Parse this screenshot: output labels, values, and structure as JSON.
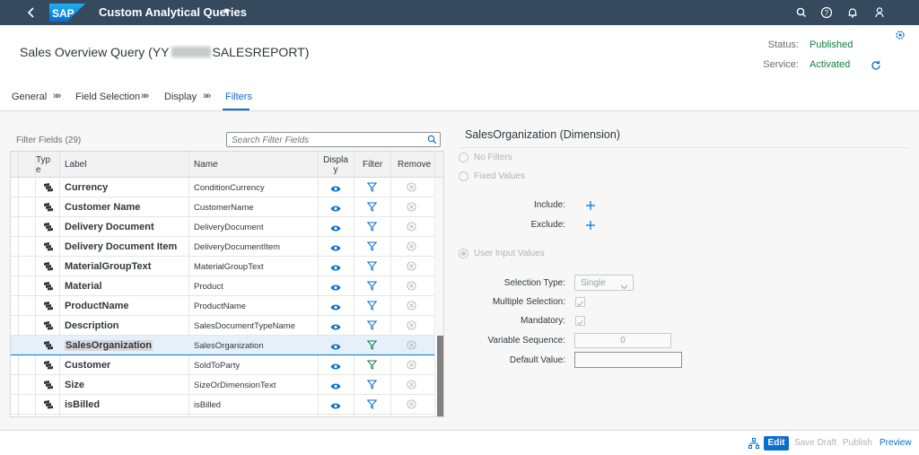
{
  "shell": {
    "logo_text": "SAP",
    "app_title": "Custom Analytical Queries",
    "icons": [
      "back-icon",
      "search-icon",
      "help-icon",
      "notifications-icon",
      "user-icon"
    ]
  },
  "header": {
    "title_prefix": "Sales Overview Query (YY",
    "title_suffix": "SALESREPORT)",
    "status_label": "Status:",
    "status_value": "Published",
    "service_label": "Service:",
    "service_value": "Activated"
  },
  "tabs": {
    "items": [
      "General",
      "Field Selection",
      "Display",
      "Filters"
    ],
    "separator": "»»",
    "selected": "Filters"
  },
  "filter_fields": {
    "title": "Filter Fields (29)",
    "search_placeholder": "Search Filter Fields",
    "columns": {
      "type": "Typ\ne",
      "label": "Label",
      "name": "Name",
      "display": "Displa\ny",
      "filter": "Filter",
      "remove": "Remove"
    },
    "rows": [
      {
        "label": "Currency",
        "name": "ConditionCurrency"
      },
      {
        "label": "Customer Name",
        "name": "CustomerName"
      },
      {
        "label": "Delivery Document",
        "name": "DeliveryDocument"
      },
      {
        "label": "Delivery Document Item",
        "name": "DeliveryDocumentItem"
      },
      {
        "label": "MaterialGroupText",
        "name": "MaterialGroupText"
      },
      {
        "label": "Material",
        "name": "Product"
      },
      {
        "label": "ProductName",
        "name": "ProductName"
      },
      {
        "label": "Description",
        "name": "SalesDocumentTypeName"
      },
      {
        "label": "SalesOrganization",
        "name": "SalesOrganization",
        "selected": true
      },
      {
        "label": "Customer",
        "name": "SoldToParty",
        "filter_active": true
      },
      {
        "label": "Size",
        "name": "SizeOrDimensionText"
      },
      {
        "label": "isBilled",
        "name": "isBilled"
      }
    ]
  },
  "detail": {
    "title": "SalesOrganization (Dimension)",
    "no_filters": "No Filters",
    "fixed_values": "Fixed Values",
    "include_label": "Include:",
    "exclude_label": "Exclude:",
    "user_input_values": "User Input Values",
    "selection_type_label": "Selection Type:",
    "selection_type_value": "Single",
    "multiple_selection_label": "Multiple Selection:",
    "mandatory_label": "Mandatory:",
    "variable_sequence_label": "Variable Sequence:",
    "variable_sequence_value": "0",
    "default_value_label": "Default Value:",
    "default_value": ""
  },
  "footer": {
    "edit": "Edit",
    "save_draft": "Save Draft",
    "publish": "Publish",
    "preview": "Preview"
  },
  "colors": {
    "shell": "#354a5f",
    "accent": "#0a6ed1",
    "positive": "#107e3e"
  }
}
